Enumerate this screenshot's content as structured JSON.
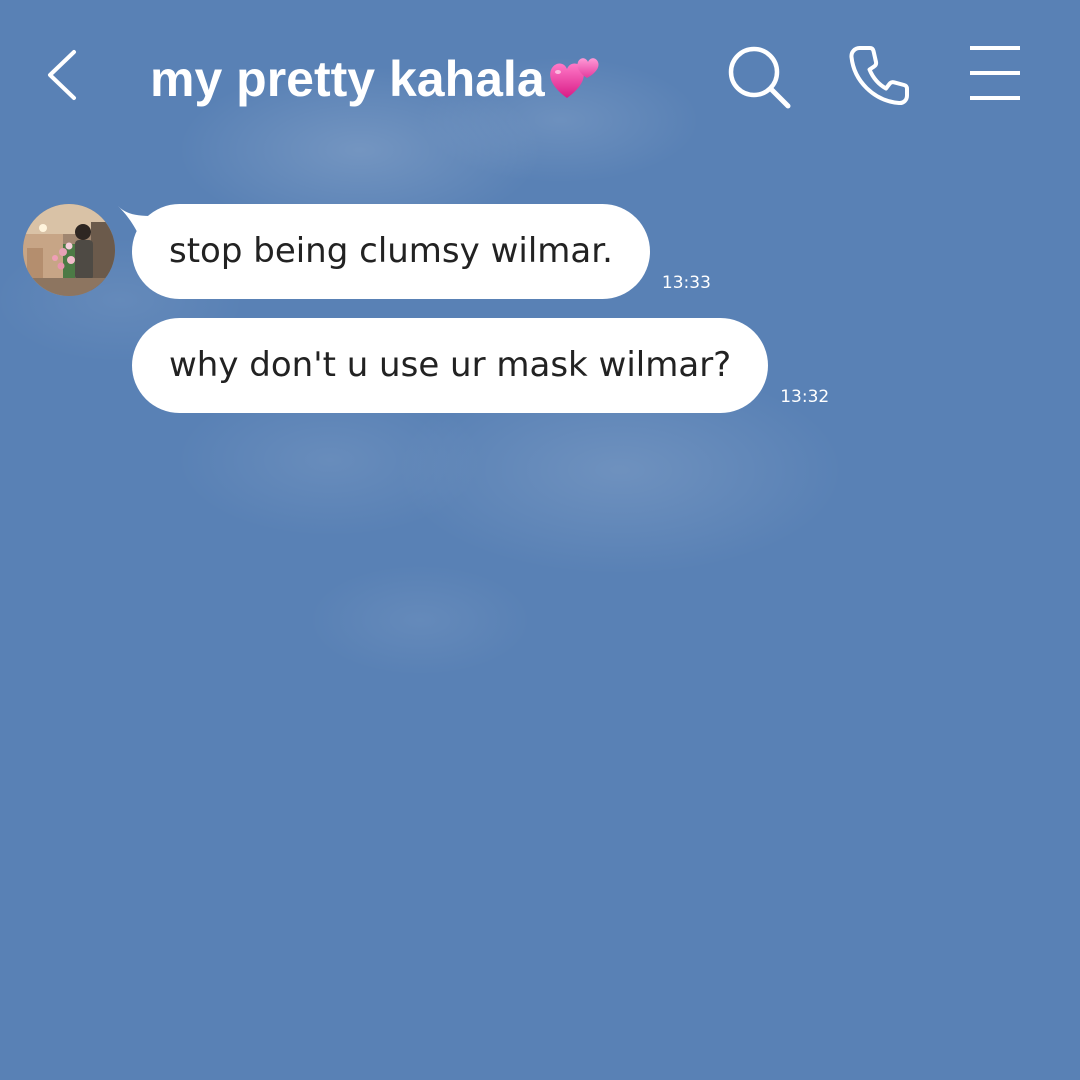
{
  "header": {
    "title": "my pretty kahala",
    "title_emoji": "two-hearts-emoji",
    "icons": [
      "chevron-left-icon",
      "search-icon",
      "phone-icon",
      "menu-icon"
    ]
  },
  "chat": {
    "messages": [
      {
        "text": "stop being clumsy wilmar.",
        "time": "13:33"
      },
      {
        "text": "why don't u use ur mask wilmar?",
        "time": "13:32"
      }
    ]
  },
  "colors": {
    "background": "#5981b5",
    "bubble": "#ffffff",
    "header_text": "#ffffff",
    "heart_emoji": "#e8399a"
  }
}
